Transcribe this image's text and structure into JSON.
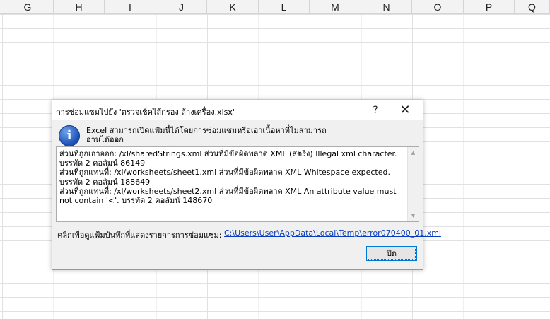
{
  "spreadsheet": {
    "columns": [
      "G",
      "H",
      "I",
      "J",
      "K",
      "L",
      "M",
      "N",
      "O",
      "P",
      "Q"
    ]
  },
  "dialog": {
    "title": "การซ่อมแซมไปยัง 'ตรวจเช็คไส้กรอง ล้างเครื่อง.xlsx'",
    "help_label": "?",
    "close_label": "✕",
    "message": "Excel สามารถเปิดแฟ้มนี้ได้โดยการซ่อมแซมหรือเอาเนื้อหาที่ไม่สามารถอ่านได้ออก",
    "message_lines": [
      "Excel สามารถเปิดแฟ้มนี้ได้โดยการซ่อมแซมหรือเอาเนื้อหาที่ไม่สามารถ",
      "อ่านได้ออก"
    ],
    "details": [
      "ส่วนที่ถูกเอาออก: /xl/sharedStrings.xml ส่วนที่มีข้อผิดพลาด XML  (สตริง) Illegal xml character. บรรทัด 2 คอลัมน์ 86149",
      "ส่วนที่ถูกแทนที่: /xl/worksheets/sheet1.xml ส่วนที่มีข้อผิดพลาด XML  Whitespace expected. บรรทัด 2 คอลัมน์ 188649",
      "ส่วนที่ถูกแทนที่: /xl/worksheets/sheet2.xml ส่วนที่มีข้อผิดพลาด XML  An attribute value must not contain '<'. บรรทัด 2 คอลัมน์ 148670"
    ],
    "log_label": "คลิกเพื่อดูแฟ้มบันทึกที่แสดงรายการการซ่อมแซม:",
    "log_link": "C:\\Users\\User\\AppData\\Local\\Temp\\error070400_01.xml",
    "close_button": "ปิด"
  },
  "icons": {
    "info": "info-icon",
    "scroll_up": "scroll-up-icon",
    "scroll_down": "scroll-down-icon"
  }
}
